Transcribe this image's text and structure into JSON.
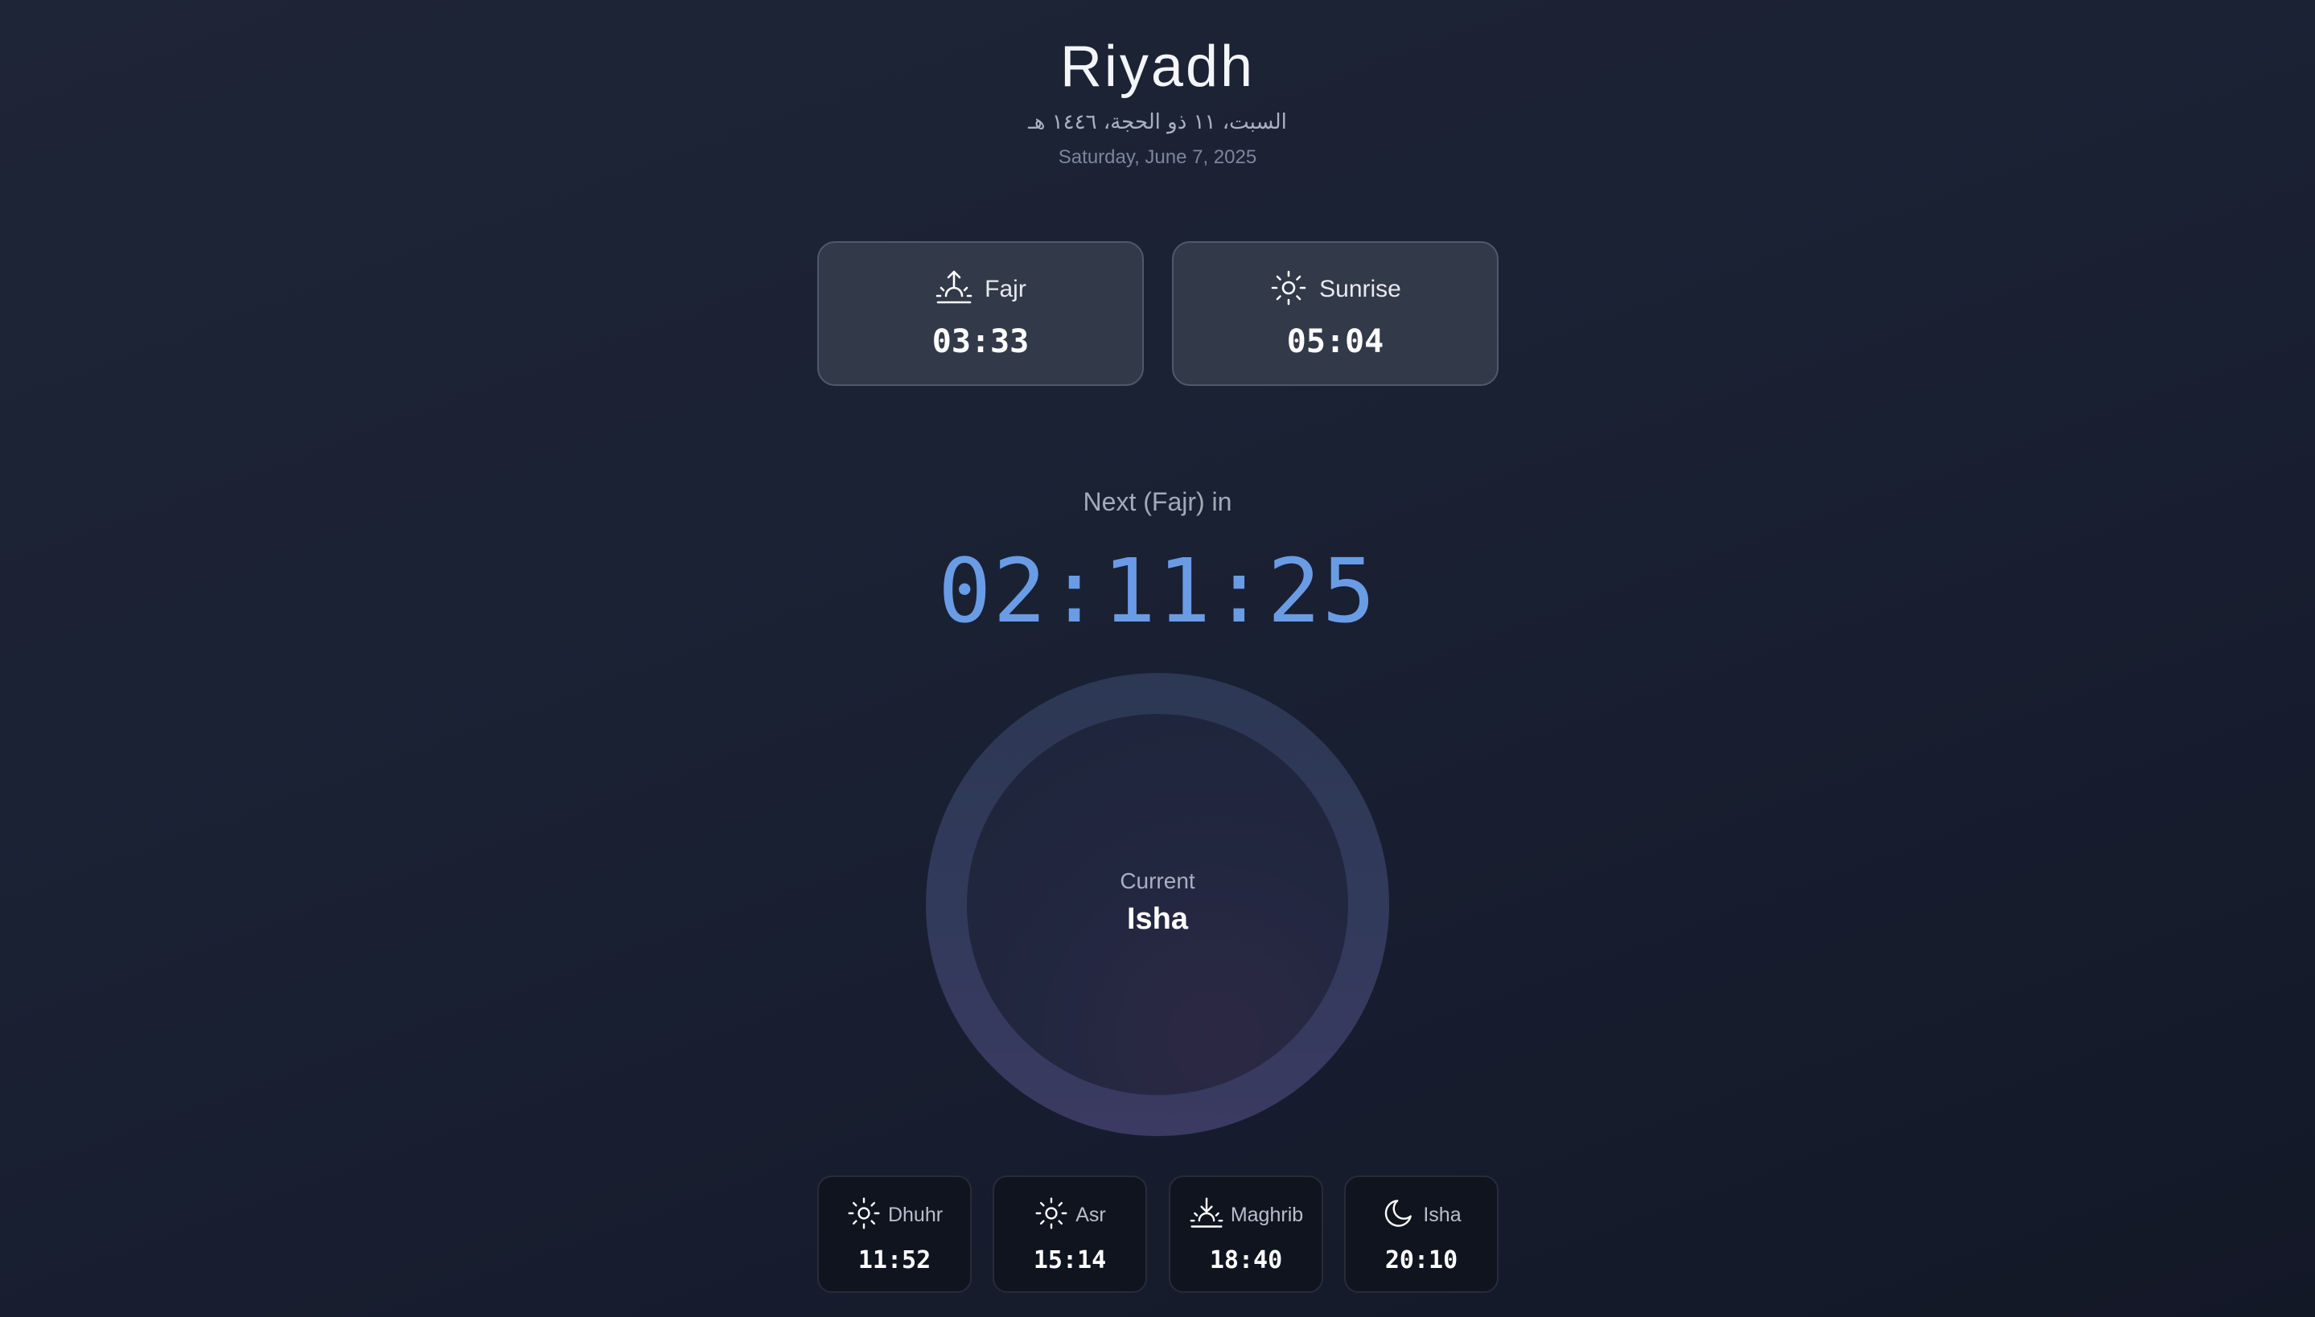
{
  "header": {
    "city": "Riyadh",
    "hijri_date": "السبت، ١١ ذو الحجة، ١٤٤٦ هـ",
    "gregorian_date": "Saturday, June 7, 2025"
  },
  "top_prayers": [
    {
      "name": "Fajr",
      "time": "03:33",
      "icon": "sunrise-up-arrow-icon"
    },
    {
      "name": "Sunrise",
      "time": "05:04",
      "icon": "sun-icon"
    }
  ],
  "next": {
    "label": "Next (Fajr) in",
    "countdown": "02:11:25"
  },
  "current": {
    "label": "Current",
    "name": "Isha"
  },
  "bottom_prayers": [
    {
      "name": "Dhuhr",
      "time": "11:52",
      "icon": "sun-icon"
    },
    {
      "name": "Asr",
      "time": "15:14",
      "icon": "sun-icon"
    },
    {
      "name": "Maghrib",
      "time": "18:40",
      "icon": "sunset-down-arrow-icon"
    },
    {
      "name": "Isha",
      "time": "20:10",
      "icon": "moon-icon"
    }
  ],
  "colors": {
    "accent": "#6a9ce6",
    "background": "#1a2133",
    "card": "#323949",
    "card_dark": "#10141f"
  }
}
